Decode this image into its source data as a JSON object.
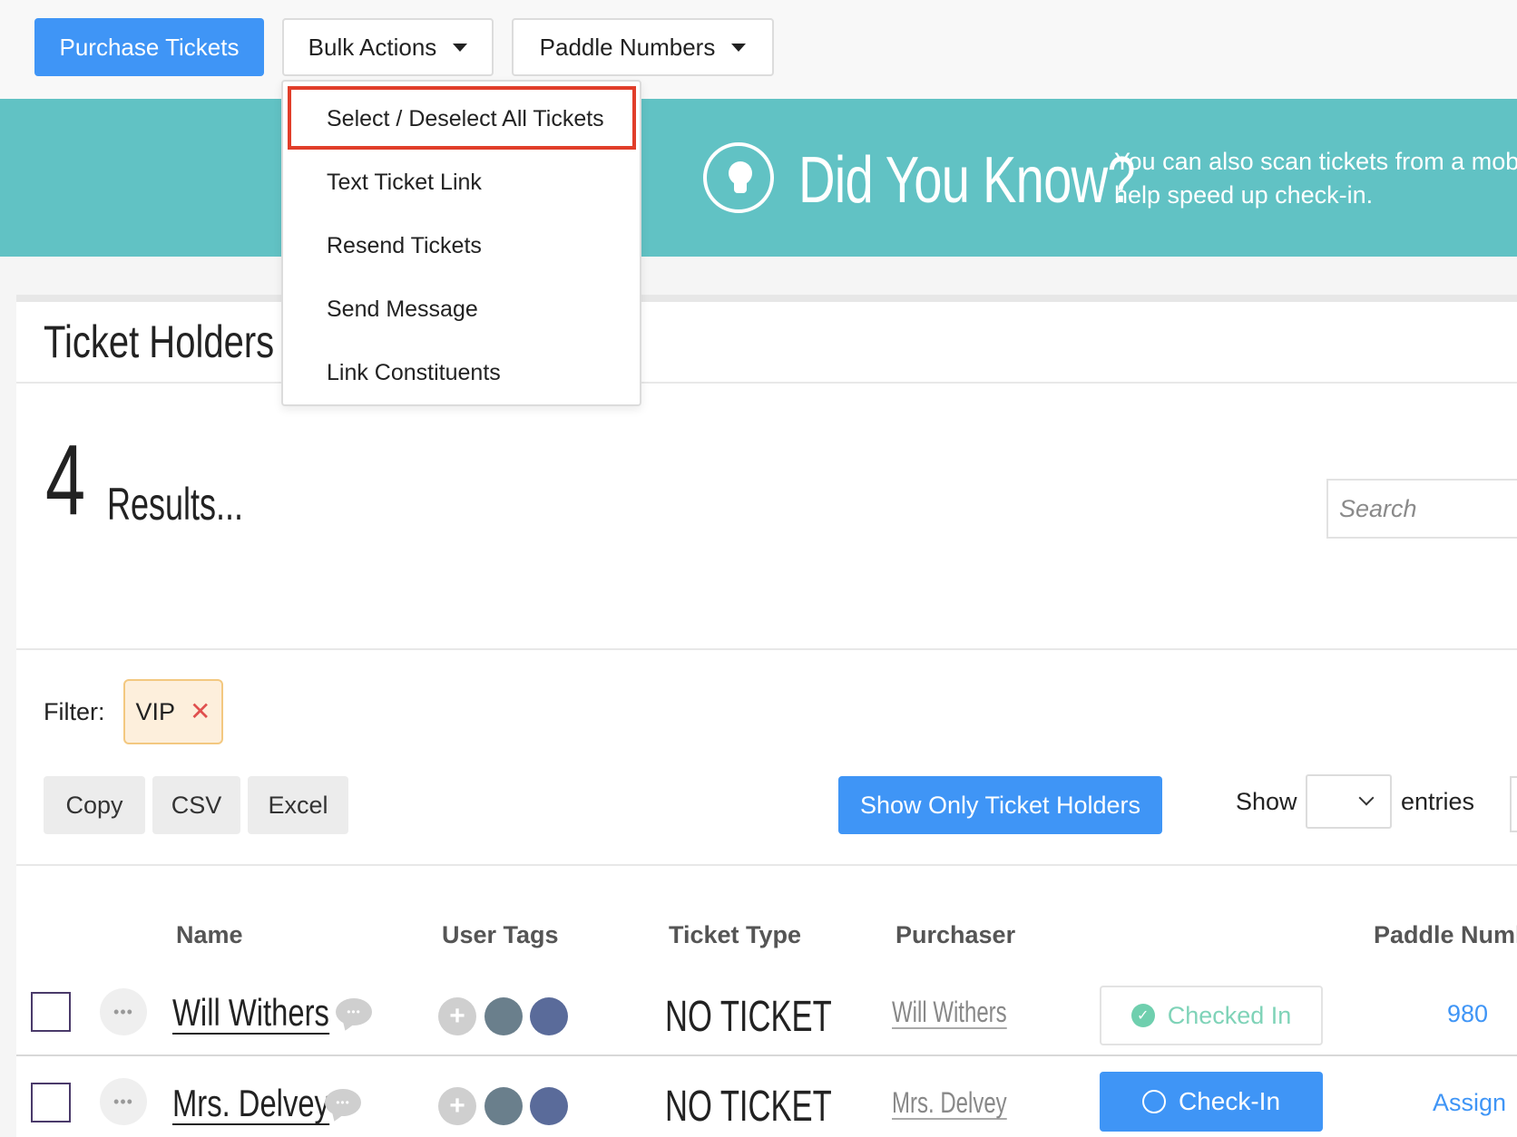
{
  "toolbar": {
    "purchase_label": "Purchase Tickets",
    "bulk_label": "Bulk Actions",
    "paddle_label": "Paddle Numbers"
  },
  "bulk_menu": {
    "items": [
      {
        "label": "Select / Deselect All Tickets"
      },
      {
        "label": "Text Ticket Link"
      },
      {
        "label": "Resend Tickets"
      },
      {
        "label": "Send Message"
      },
      {
        "label": "Link Constituents"
      }
    ]
  },
  "banner": {
    "title": "Did You Know?",
    "line1": "You can also scan tickets from a mob",
    "line2": "help speed up check-in."
  },
  "panel": {
    "title": "Ticket Holders",
    "count": "4",
    "count_label": "Results...",
    "search_placeholder": "Search"
  },
  "filter": {
    "label": "Filter:",
    "tag": "VIP"
  },
  "export_buttons": {
    "copy": "Copy",
    "csv": "CSV",
    "excel": "Excel"
  },
  "show_only_label": "Show Only Ticket Holders",
  "entries": {
    "show": "Show",
    "entries": "entries"
  },
  "table": {
    "headers": {
      "name": "Name",
      "user_tags": "User Tags",
      "ticket_type": "Ticket Type",
      "purchaser": "Purchaser",
      "paddle": "Paddle Numl"
    },
    "rows": [
      {
        "name": "Will Withers",
        "ticket_type": "NO TICKET",
        "purchaser": "Will Withers",
        "status": "Checked In",
        "paddle": "980"
      },
      {
        "name": "Mrs. Delvey",
        "ticket_type": "NO TICKET",
        "purchaser": "Mrs. Delvey",
        "status": "Check-In",
        "paddle": "Assign"
      }
    ]
  },
  "colors": {
    "primary": "#3f95f6",
    "banner": "#61c2c4",
    "highlight": "#e13e2a",
    "tag_dot_1": "#6a7f8c",
    "tag_dot_2": "#5a6b9a",
    "checked": "#6fcfae"
  }
}
